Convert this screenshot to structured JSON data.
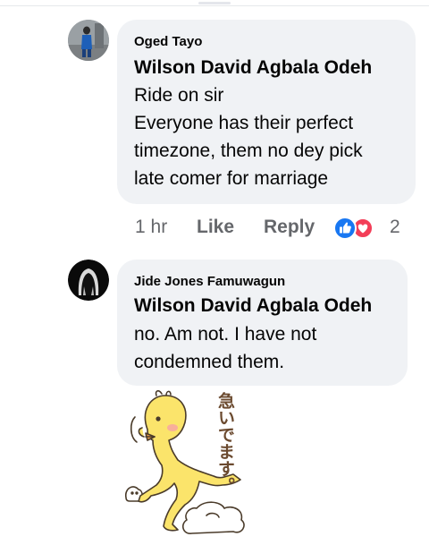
{
  "comments": [
    {
      "author": "Oged Tayo",
      "mention": "Wilson David Agbala Odeh",
      "lines": [
        "Ride on sir",
        "Everyone has their perfect",
        "timezone, them no dey pick",
        "late comer for marriage"
      ],
      "time": "1 hr",
      "like_label": "Like",
      "reply_label": "Reply",
      "reaction_count": "2",
      "reaction_icons": [
        "like-reaction-icon",
        "love-reaction-icon"
      ]
    },
    {
      "author": "Jide Jones Famuwagun",
      "mention": "Wilson David Agbala Odeh",
      "lines": [
        "no. Am not. I have not",
        "condemned them."
      ]
    }
  ],
  "sticker": {
    "caption": "急いでます。",
    "icon": "running-chick-sticker"
  },
  "colors": {
    "bubble": "#f0f2f5",
    "meta": "#65676b",
    "like_blue": "#1877f2",
    "love_red": "#f33e58",
    "chick_yellow": "#fbe46b"
  }
}
